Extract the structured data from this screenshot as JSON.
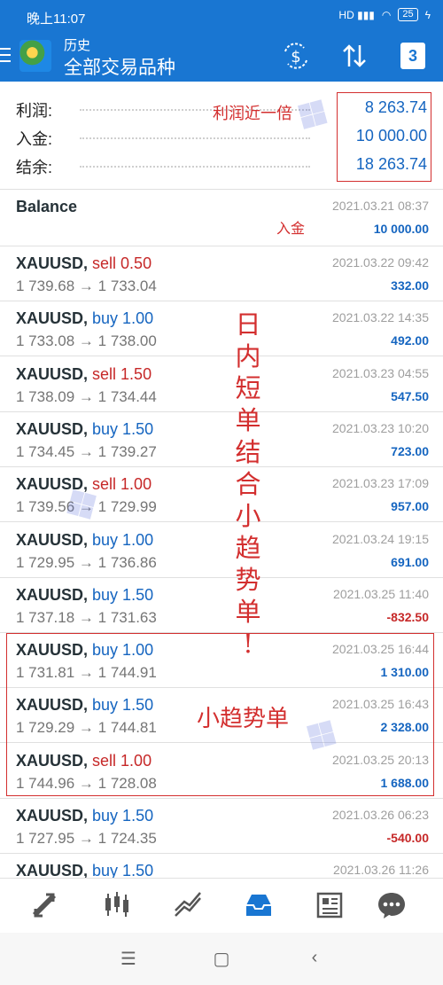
{
  "status_bar": {
    "time": "晚上11:07",
    "signal_label": "HD",
    "battery": "25"
  },
  "app_bar": {
    "subtitle": "历史",
    "title": "全部交易品种",
    "icons": [
      "app-logo-icon",
      "currency-exchange-icon",
      "sort-icon",
      "calendar-icon"
    ],
    "calendar_day": "3"
  },
  "summary": {
    "profit_label": "利润:",
    "profit_value": "8 263.74",
    "deposit_label": "入金:",
    "deposit_value": "10 000.00",
    "balance_label": "结余:",
    "balance_value": "18 263.74"
  },
  "balance_entry": {
    "label": "Balance",
    "date": "2021.03.21 08:37",
    "amount": "10 000.00"
  },
  "deals": [
    {
      "symbol": "XAUUSD,",
      "side": "sell 0.50",
      "type": "sell",
      "open": "1 739.68",
      "close": "1 733.04",
      "date": "2021.03.22 09:42",
      "profit": "332.00",
      "sign": "pos"
    },
    {
      "symbol": "XAUUSD,",
      "side": "buy 1.00",
      "type": "buy",
      "open": "1 733.08",
      "close": "1 738.00",
      "date": "2021.03.22 14:35",
      "profit": "492.00",
      "sign": "pos"
    },
    {
      "symbol": "XAUUSD,",
      "side": "sell 1.50",
      "type": "sell",
      "open": "1 738.09",
      "close": "1 734.44",
      "date": "2021.03.23 04:55",
      "profit": "547.50",
      "sign": "pos"
    },
    {
      "symbol": "XAUUSD,",
      "side": "buy 1.50",
      "type": "buy",
      "open": "1 734.45",
      "close": "1 739.27",
      "date": "2021.03.23 10:20",
      "profit": "723.00",
      "sign": "pos"
    },
    {
      "symbol": "XAUUSD,",
      "side": "sell 1.00",
      "type": "sell",
      "open": "1 739.56",
      "close": "1 729.99",
      "date": "2021.03.23 17:09",
      "profit": "957.00",
      "sign": "pos"
    },
    {
      "symbol": "XAUUSD,",
      "side": "buy 1.00",
      "type": "buy",
      "open": "1 729.95",
      "close": "1 736.86",
      "date": "2021.03.24 19:15",
      "profit": "691.00",
      "sign": "pos"
    },
    {
      "symbol": "XAUUSD,",
      "side": "buy 1.50",
      "type": "buy",
      "open": "1 737.18",
      "close": "1 731.63",
      "date": "2021.03.25 11:40",
      "profit": "-832.50",
      "sign": "neg"
    },
    {
      "symbol": "XAUUSD,",
      "side": "buy 1.00",
      "type": "buy",
      "open": "1 731.81",
      "close": "1 744.91",
      "date": "2021.03.25 16:44",
      "profit": "1 310.00",
      "sign": "pos"
    },
    {
      "symbol": "XAUUSD,",
      "side": "buy 1.50",
      "type": "buy",
      "open": "1 729.29",
      "close": "1 744.81",
      "date": "2021.03.25 16:43",
      "profit": "2 328.00",
      "sign": "pos"
    },
    {
      "symbol": "XAUUSD,",
      "side": "sell 1.00",
      "type": "sell",
      "open": "1 744.96",
      "close": "1 728.08",
      "date": "2021.03.25 20:13",
      "profit": "1 688.00",
      "sign": "pos"
    },
    {
      "symbol": "XAUUSD,",
      "side": "buy 1.50",
      "type": "buy",
      "open": "1 727.95",
      "close": "1 724.35",
      "date": "2021.03.26 06:23",
      "profit": "-540.00",
      "sign": "neg"
    },
    {
      "symbol": "XAUUSD,",
      "side": "buy 1.50",
      "type": "buy",
      "open": "",
      "close": "",
      "date": "2021.03.26 11:26",
      "profit": "",
      "sign": "pos"
    }
  ],
  "annotations": {
    "profit_note": "利润近一倍",
    "deposit_note": "入金",
    "vertical_note": "日内短单结合小趋势单!",
    "trend_note": "小趋势单"
  },
  "bottom_nav": {
    "items": [
      "quotes-icon",
      "chart-icon",
      "trade-icon",
      "history-icon",
      "news-icon",
      "chat-icon"
    ],
    "active": "history-icon"
  },
  "system_nav": [
    "menu-icon",
    "home-icon",
    "back-icon"
  ],
  "colors": {
    "primary": "#1976d2",
    "buy": "#1565c0",
    "sell": "#c62828",
    "annotation": "#d32f2f"
  }
}
